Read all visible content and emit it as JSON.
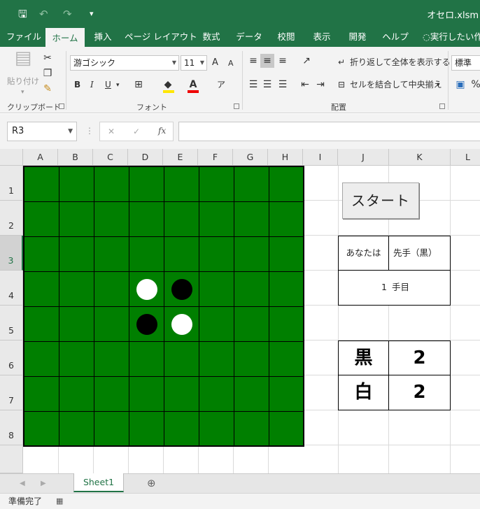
{
  "titlebar": {
    "file_title": "オセロ.xlsm",
    "qa_save": "🖫",
    "qa_undo": "↶",
    "qa_redo": "↷",
    "qa_custom": "▾"
  },
  "tabs": [
    "ファイル",
    "ホーム",
    "挿入",
    "ページ レイアウト",
    "数式",
    "データ",
    "校閲",
    "表示",
    "開発",
    "ヘルプ",
    "実行したい作業"
  ],
  "ribbon": {
    "clipboard": {
      "paste": "貼り付け",
      "label": "クリップボード"
    },
    "font": {
      "name": "游ゴシック",
      "size": "11",
      "bold": "B",
      "italic": "I",
      "underline": "U",
      "grow": "A",
      "shrink": "A",
      "label": "フォント"
    },
    "alignment": {
      "wrap": "折り返して全体を表示する",
      "merge": "セルを結合して中央揃え",
      "label": "配置"
    },
    "number": {
      "format": "標準"
    }
  },
  "formula_bar": {
    "name_box": "R3",
    "fx": "fx",
    "cancel": "✕",
    "enter": "✓",
    "formula": ""
  },
  "columns": [
    "A",
    "B",
    "C",
    "D",
    "E",
    "F",
    "G",
    "H",
    "I",
    "J",
    "K",
    "L"
  ],
  "rows": [
    "1",
    "2",
    "3",
    "4",
    "5",
    "6",
    "7",
    "8"
  ],
  "board": {
    "size": 8,
    "discs": [
      {
        "row": 4,
        "col": "D",
        "color": "white"
      },
      {
        "row": 4,
        "col": "E",
        "color": "black"
      },
      {
        "row": 5,
        "col": "D",
        "color": "black"
      },
      {
        "row": 5,
        "col": "E",
        "color": "white"
      }
    ]
  },
  "start_button": "スタート",
  "info": {
    "you_are_label": "あなたは",
    "you_are_value": "先手（黒）",
    "turn_number": "1",
    "turn_suffix": "手目"
  },
  "score": {
    "black_label": "黒",
    "black_count": "2",
    "white_label": "白",
    "white_count": "2"
  },
  "sheet_tab": "Sheet1",
  "status": "準備完了",
  "colors": {
    "excel_green": "#217346",
    "board_green": "#007f00"
  }
}
